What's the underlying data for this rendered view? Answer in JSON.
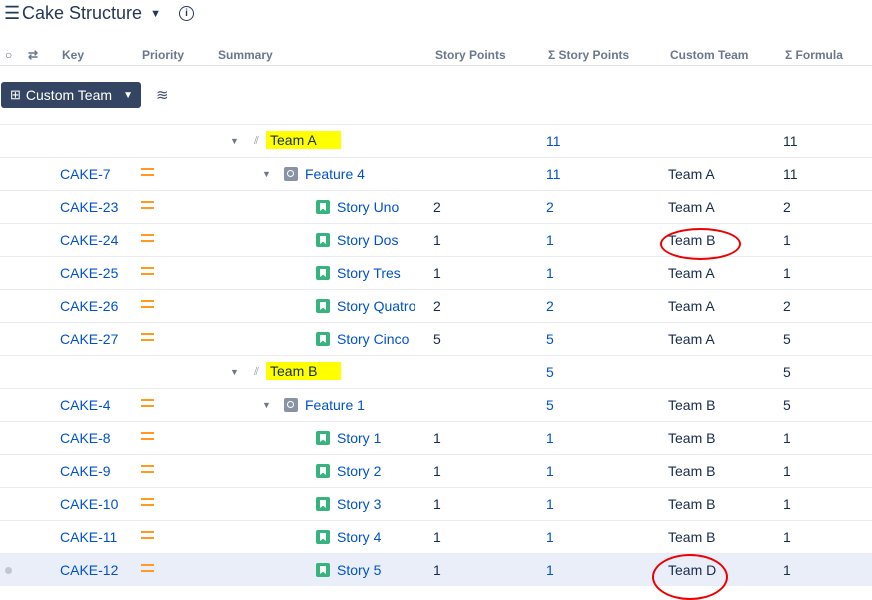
{
  "title": "Cake Structure",
  "headers": {
    "key": "Key",
    "priority": "Priority",
    "summary": "Summary",
    "story_points": "Story Points",
    "sum_story_points": "Σ Story Points",
    "custom_team": "Custom Team",
    "formula": "Σ Formula"
  },
  "group_button": "Custom Team",
  "rows": [
    {
      "type": "group",
      "summary": "Team A",
      "ssp": "11",
      "formula": "11"
    },
    {
      "type": "feature",
      "key": "CAKE-7",
      "summary": "Feature 4",
      "ssp": "11",
      "team": "Team A",
      "formula": "11"
    },
    {
      "type": "story",
      "key": "CAKE-23",
      "summary": "Story Uno",
      "sp": "2",
      "ssp": "2",
      "team": "Team A",
      "formula": "2"
    },
    {
      "type": "story",
      "key": "CAKE-24",
      "summary": "Story Dos",
      "sp": "1",
      "ssp": "1",
      "team": "Team B",
      "formula": "1"
    },
    {
      "type": "story",
      "key": "CAKE-25",
      "summary": "Story Tres",
      "sp": "1",
      "ssp": "1",
      "team": "Team A",
      "formula": "1"
    },
    {
      "type": "story",
      "key": "CAKE-26",
      "summary": "Story Quatro",
      "sp": "2",
      "ssp": "2",
      "team": "Team A",
      "formula": "2"
    },
    {
      "type": "story",
      "key": "CAKE-27",
      "summary": "Story Cinco",
      "sp": "5",
      "ssp": "5",
      "team": "Team A",
      "formula": "5"
    },
    {
      "type": "group",
      "summary": "Team B",
      "ssp": "5",
      "formula": "5"
    },
    {
      "type": "feature",
      "key": "CAKE-4",
      "summary": "Feature 1",
      "ssp": "5",
      "team": "Team B",
      "formula": "5"
    },
    {
      "type": "story",
      "key": "CAKE-8",
      "summary": "Story 1",
      "sp": "1",
      "ssp": "1",
      "team": "Team B",
      "formula": "1"
    },
    {
      "type": "story",
      "key": "CAKE-9",
      "summary": "Story 2",
      "sp": "1",
      "ssp": "1",
      "team": "Team B",
      "formula": "1"
    },
    {
      "type": "story",
      "key": "CAKE-10",
      "summary": "Story 3",
      "sp": "1",
      "ssp": "1",
      "team": "Team B",
      "formula": "1"
    },
    {
      "type": "story",
      "key": "CAKE-11",
      "summary": "Story 4",
      "sp": "1",
      "ssp": "1",
      "team": "Team B",
      "formula": "1"
    },
    {
      "type": "story",
      "key": "CAKE-12",
      "summary": "Story 5",
      "sp": "1",
      "ssp": "1",
      "team": "Team D",
      "formula": "1",
      "selected": true
    }
  ]
}
